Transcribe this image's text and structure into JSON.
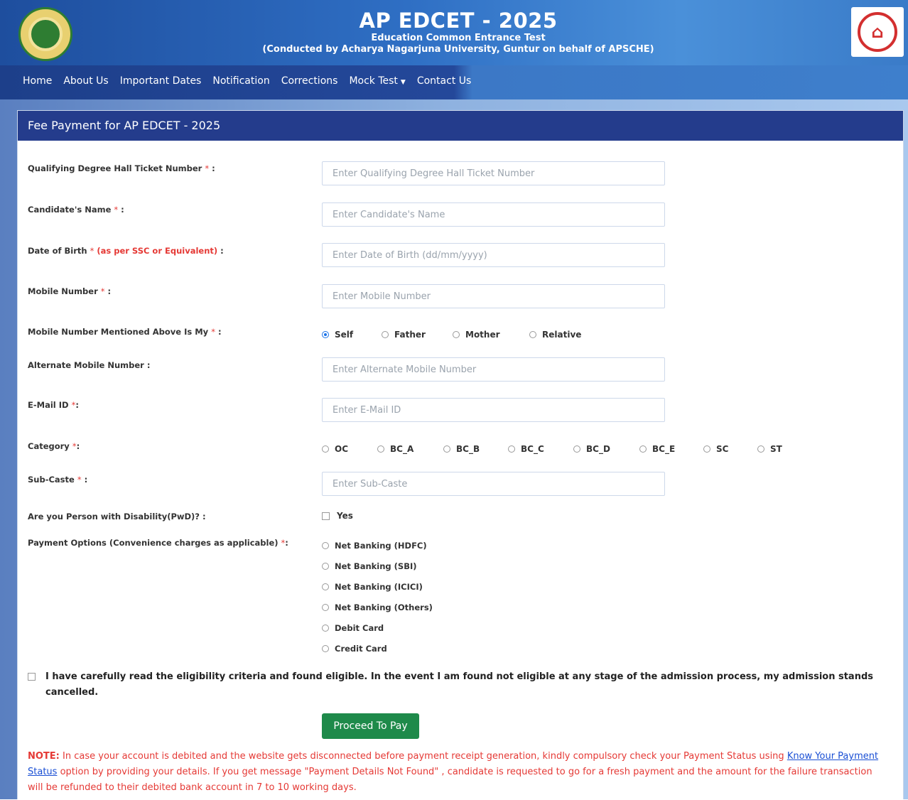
{
  "header": {
    "title": "AP EDCET - 2025",
    "subtitle": "Education Common Entrance Test",
    "subtitle2": "(Conducted by Acharya Nagarjuna University, Guntur on behalf of APSCHE)"
  },
  "nav": {
    "items": [
      "Home",
      "About Us",
      "Important Dates",
      "Notification",
      "Corrections",
      "Mock Test",
      "Contact Us"
    ]
  },
  "card": {
    "title": "Fee Payment for AP EDCET - 2025"
  },
  "form": {
    "hall_ticket_label": "Qualifying Degree Hall Ticket Number",
    "hall_ticket_placeholder": "Enter Qualifying Degree Hall Ticket Number",
    "name_label": "Candidate's Name",
    "name_placeholder": "Enter Candidate's Name",
    "dob_label": "Date of Birth",
    "dob_note": "(as per SSC or Equivalent)",
    "dob_placeholder": "Enter Date of Birth (dd/mm/yyyy)",
    "mobile_label": "Mobile Number",
    "mobile_placeholder": "Enter Mobile Number",
    "mobile_owner_label": "Mobile Number Mentioned Above Is My",
    "mobile_owner_options": [
      "Self",
      "Father",
      "Mother",
      "Relative"
    ],
    "mobile_owner_selected": "Self",
    "alt_mobile_label": "Alternate Mobile Number :",
    "alt_mobile_placeholder": "Enter Alternate Mobile Number",
    "email_label": "E-Mail ID",
    "email_placeholder": "Enter E-Mail ID",
    "category_label": "Category",
    "category_options": [
      "OC",
      "BC_A",
      "BC_B",
      "BC_C",
      "BC_D",
      "BC_E",
      "SC",
      "ST"
    ],
    "subcaste_label": "Sub-Caste",
    "subcaste_placeholder": "Enter Sub-Caste",
    "pwd_label": "Are you Person with Disability(PwD)? :",
    "pwd_option": "Yes",
    "payment_label": "Payment Options (Convenience charges as applicable)",
    "payment_options": [
      "Net Banking (HDFC)",
      "Net Banking (SBI)",
      "Net Banking (ICICI)",
      "Net Banking (Others)",
      "Debit Card",
      "Credit Card"
    ],
    "declaration": "I have carefully read the eligibility criteria and found eligible. In the event I am found not eligible at any stage of the admission process, my admission stands cancelled.",
    "proceed_button": "Proceed To Pay"
  },
  "note": {
    "prefix": "NOTE:",
    "text1": " In case your account is debited and the website gets disconnected before payment receipt generation, kindly compulsory check your Payment Status using ",
    "link": "Know Your Payment Status",
    "text2": " option by providing your details. If you get message \"Payment Details Not Found\" , candidate is requested to go for a fresh payment and the amount for the failure transaction will be refunded to their debited bank account in 7 to 10 working days."
  },
  "colors": {
    "header_blue": "#1e4e9e",
    "card_header": "#243c8c",
    "button_green": "#1e8a4a",
    "required_red": "#e53935",
    "link_blue": "#1a4fd4"
  }
}
